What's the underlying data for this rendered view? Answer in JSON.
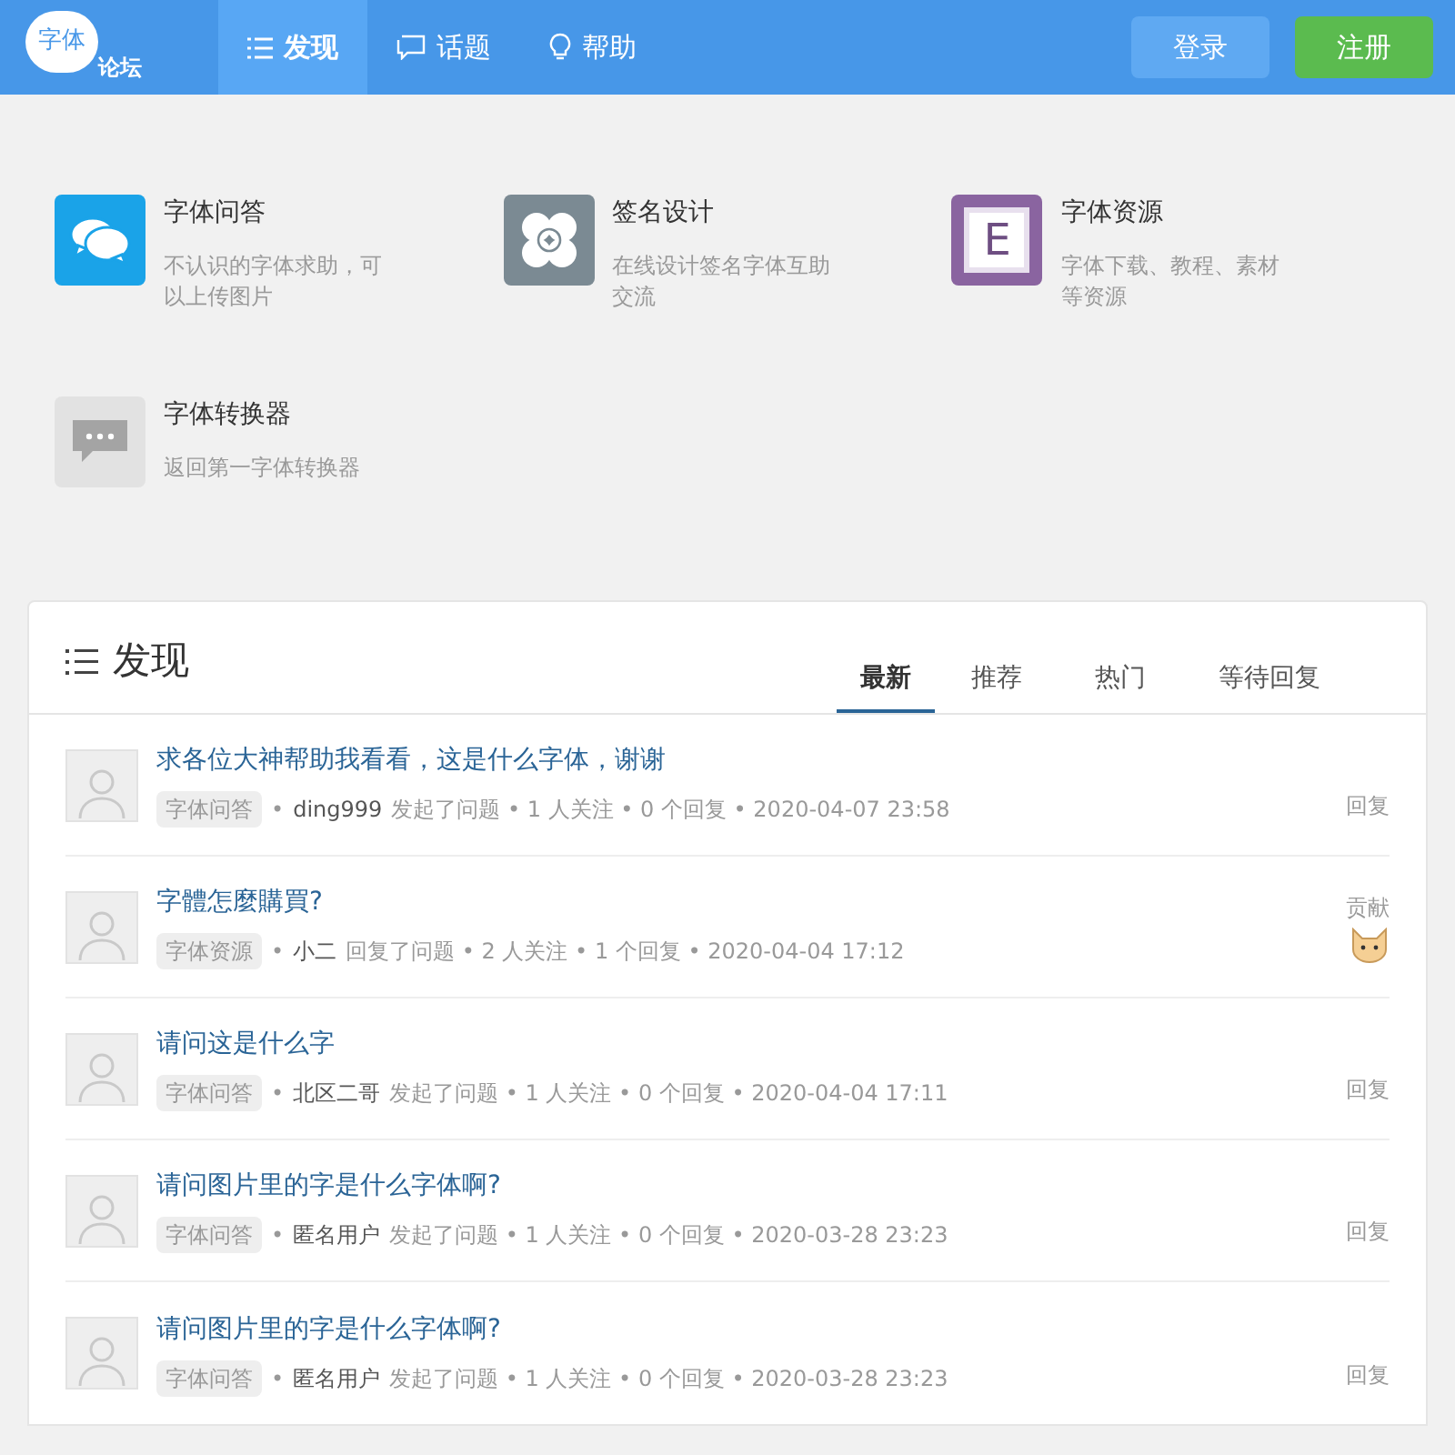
{
  "logo": {
    "line1": "字体",
    "line2": "论坛"
  },
  "nav": [
    {
      "label": "发现",
      "kind": "list",
      "selected": true
    },
    {
      "label": "话题",
      "kind": "chat",
      "selected": false
    },
    {
      "label": "帮助",
      "kind": "bulb",
      "selected": false
    }
  ],
  "auth": {
    "login": "登录",
    "register": "注册"
  },
  "categories": [
    {
      "title": "字体问答",
      "desc": "不认识的字体求助，可以上传图片",
      "kind": "bubbles"
    },
    {
      "title": "签名设计",
      "desc": "在线设计签名字体互助交流",
      "kind": "circles"
    },
    {
      "title": "字体资源",
      "desc": "字体下载、教程、素材等资源",
      "kind": "letter",
      "letter": "E"
    },
    {
      "title": "字体转换器",
      "desc": "返回第一字体转换器",
      "kind": "message"
    }
  ],
  "panel": {
    "title": "发现",
    "tabs": [
      {
        "label": "最新",
        "selected": true
      },
      {
        "label": "推荐",
        "selected": false
      },
      {
        "label": "热门",
        "selected": false
      },
      {
        "label": "等待回复",
        "selected": false
      }
    ],
    "posts": [
      {
        "title": "求各位大神帮助我看看，这是什么字体，谢谢",
        "category": "字体问答",
        "bullet": "•",
        "user": "ding999",
        "details": "发起了问题 • 1 人关注 • 0 个回复 • 2020-04-07 23:58",
        "kind": "reply",
        "side": "回复"
      },
      {
        "title": "字體怎麼購買?",
        "category": "字体资源",
        "bullet": "•",
        "user": "小二",
        "details": "回复了问题 • 2 人关注 • 1 个回复 • 2020-04-04 17:12",
        "kind": "contribution",
        "side": "贡献"
      },
      {
        "title": "请问这是什么字",
        "category": "字体问答",
        "bullet": "•",
        "user": "北区二哥",
        "details": "发起了问题 • 1 人关注 • 0 个回复 • 2020-04-04 17:11",
        "kind": "reply",
        "side": "回复"
      },
      {
        "title": "请问图片里的字是什么字体啊?",
        "category": "字体问答",
        "bullet": "•",
        "user": "匿名用户",
        "details": "发起了问题 • 1 人关注 • 0 个回复 • 2020-03-28 23:23",
        "kind": "reply",
        "side": "回复"
      },
      {
        "title": "请问图片里的字是什么字体啊?",
        "category": "字体问答",
        "bullet": "•",
        "user": "匿名用户",
        "details": "发起了问题 • 1 人关注 • 0 个回复 • 2020-03-28 23:23",
        "kind": "reply",
        "side": "回复"
      }
    ]
  }
}
